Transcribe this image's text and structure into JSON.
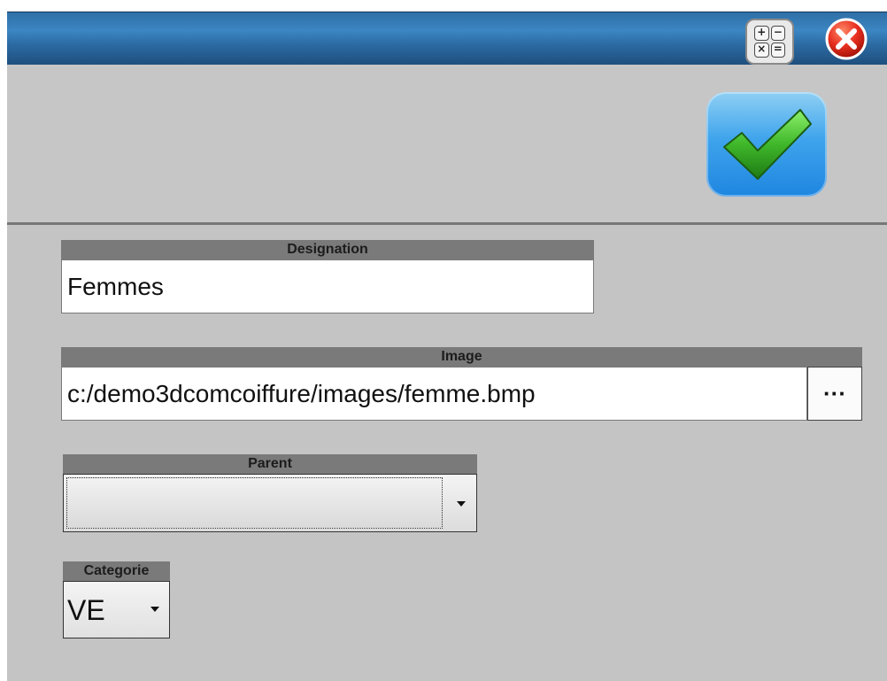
{
  "toolbar": {
    "calculator_symbols": [
      "+",
      "−",
      "×",
      "="
    ],
    "close_label": "Close",
    "ok_label": "Validate"
  },
  "form": {
    "designation": {
      "label": "Designation",
      "value": "Femmes"
    },
    "image": {
      "label": "Image",
      "value": "c:/demo3dcomcoiffure/images/femme.bmp",
      "browse_label": "···"
    },
    "parent": {
      "label": "Parent",
      "value": ""
    },
    "categorie": {
      "label": "Categorie",
      "value": "VE"
    }
  },
  "colors": {
    "titlebar": "#2f6fa6",
    "background": "#c4c4c4",
    "header": "#7a7a7a",
    "ok_button": "#3fa4ec",
    "check": "#3fb72a",
    "close": "#e8301f"
  },
  "icons": [
    "calculator-icon",
    "close-icon",
    "checkmark-icon",
    "dropdown-arrow-icon"
  ]
}
